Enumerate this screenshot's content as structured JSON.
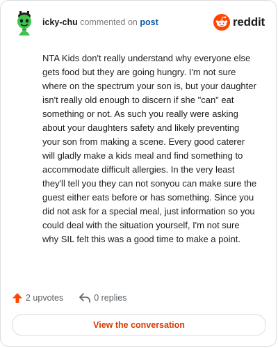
{
  "header": {
    "username": "icky-chu",
    "action_text": "commented on",
    "post_link_text": "post",
    "brand_name": "reddit",
    "brand_color": "#ff4500"
  },
  "comment": {
    "body": "NTA Kids don't really understand why everyone else gets food but they are going hungry. I'm not sure where on the spectrum your son is, but your daughter isn't really old enough to discern if she \"can\" eat something or not. As such you really were asking about your daughters safety and likely preventing your son from making a scene. Every good caterer will gladly make a kids meal and find something to accommodate difficult allergies. In the very least they'll tell you they can not sonyou can make sure the guest either eats before or has something. Since you did not ask for a special meal, just information so you could deal with the situation yourself, I'm not sure why SIL felt this was a good time to make a point."
  },
  "actions": {
    "upvotes_label": "2 upvotes",
    "upvote_icon": "upvote-arrow-icon",
    "upvote_color": "#ff4500",
    "replies_label": "0 replies",
    "reply_icon": "reply-arrow-icon"
  },
  "cta": {
    "label": "View the conversation",
    "color": "#d93a00"
  }
}
